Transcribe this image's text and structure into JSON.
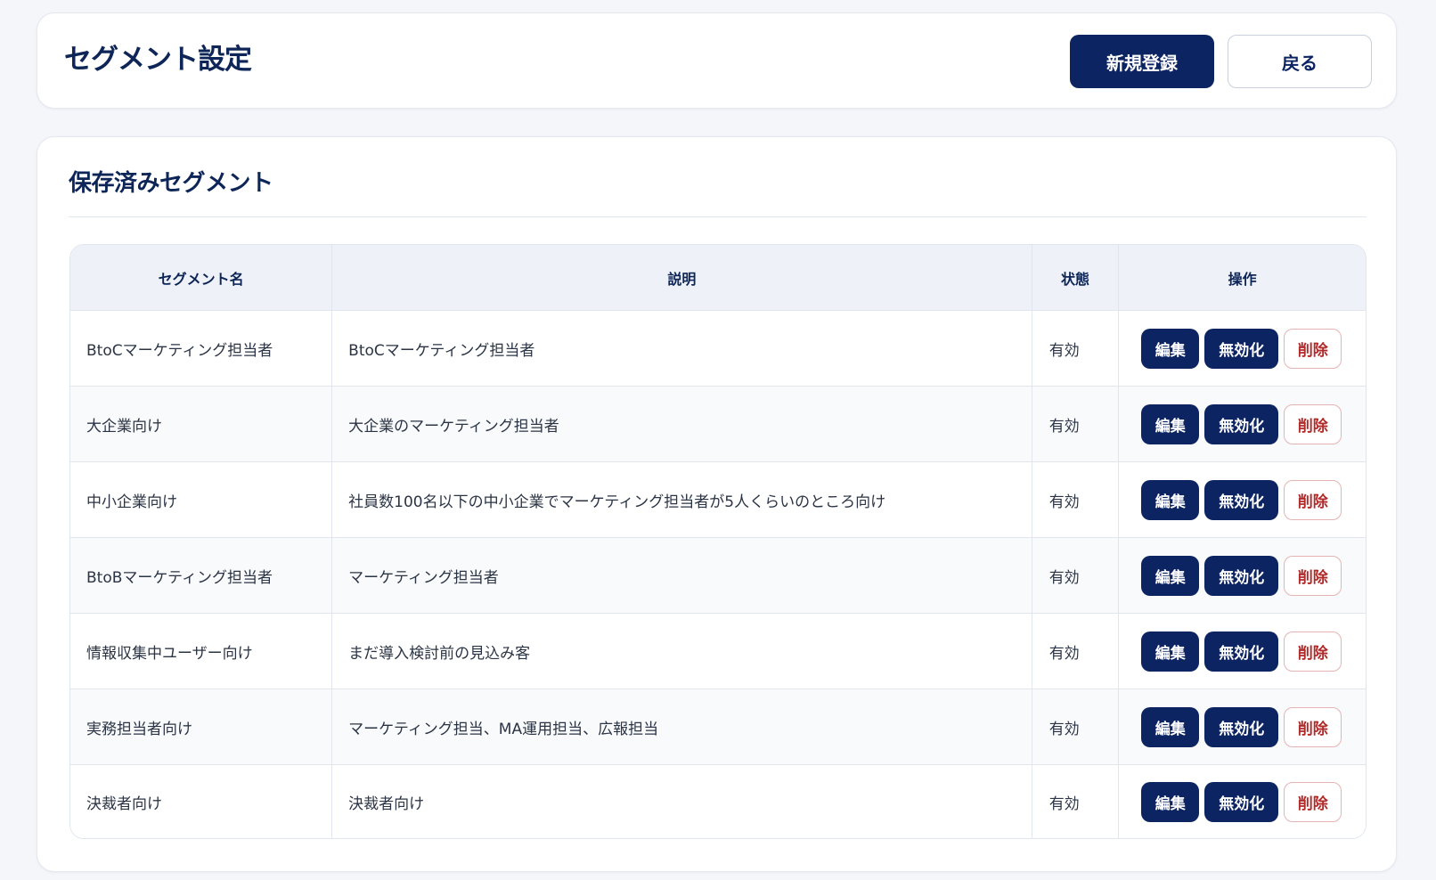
{
  "header": {
    "title": "セグメント設定",
    "new_button": "新規登録",
    "back_button": "戻る"
  },
  "section": {
    "title": "保存済みセグメント"
  },
  "table": {
    "columns": [
      "セグメント名",
      "説明",
      "状態",
      "操作"
    ],
    "rows": [
      {
        "name": "BtoCマーケティング担当者",
        "description": "BtoCマーケティング担当者",
        "status": "有効"
      },
      {
        "name": "大企業向け",
        "description": "大企業のマーケティング担当者",
        "status": "有効"
      },
      {
        "name": "中小企業向け",
        "description": "社員数100名以下の中小企業でマーケティング担当者が5人くらいのところ向け",
        "status": "有効"
      },
      {
        "name": "BtoBマーケティング担当者",
        "description": "マーケティング担当者",
        "status": "有効"
      },
      {
        "name": "情報収集中ユーザー向け",
        "description": "まだ導入検討前の見込み客",
        "status": "有効"
      },
      {
        "name": "実務担当者向け",
        "description": "マーケティング担当、MA運用担当、広報担当",
        "status": "有効"
      },
      {
        "name": "決裁者向け",
        "description": "決裁者向け",
        "status": "有効"
      }
    ],
    "actions": {
      "edit": "編集",
      "disable": "無効化",
      "delete": "削除"
    }
  },
  "colors": {
    "primary": "#0c2462",
    "title": "#0d2557",
    "danger": "#b02a2a",
    "background": "#f4f6fa"
  }
}
